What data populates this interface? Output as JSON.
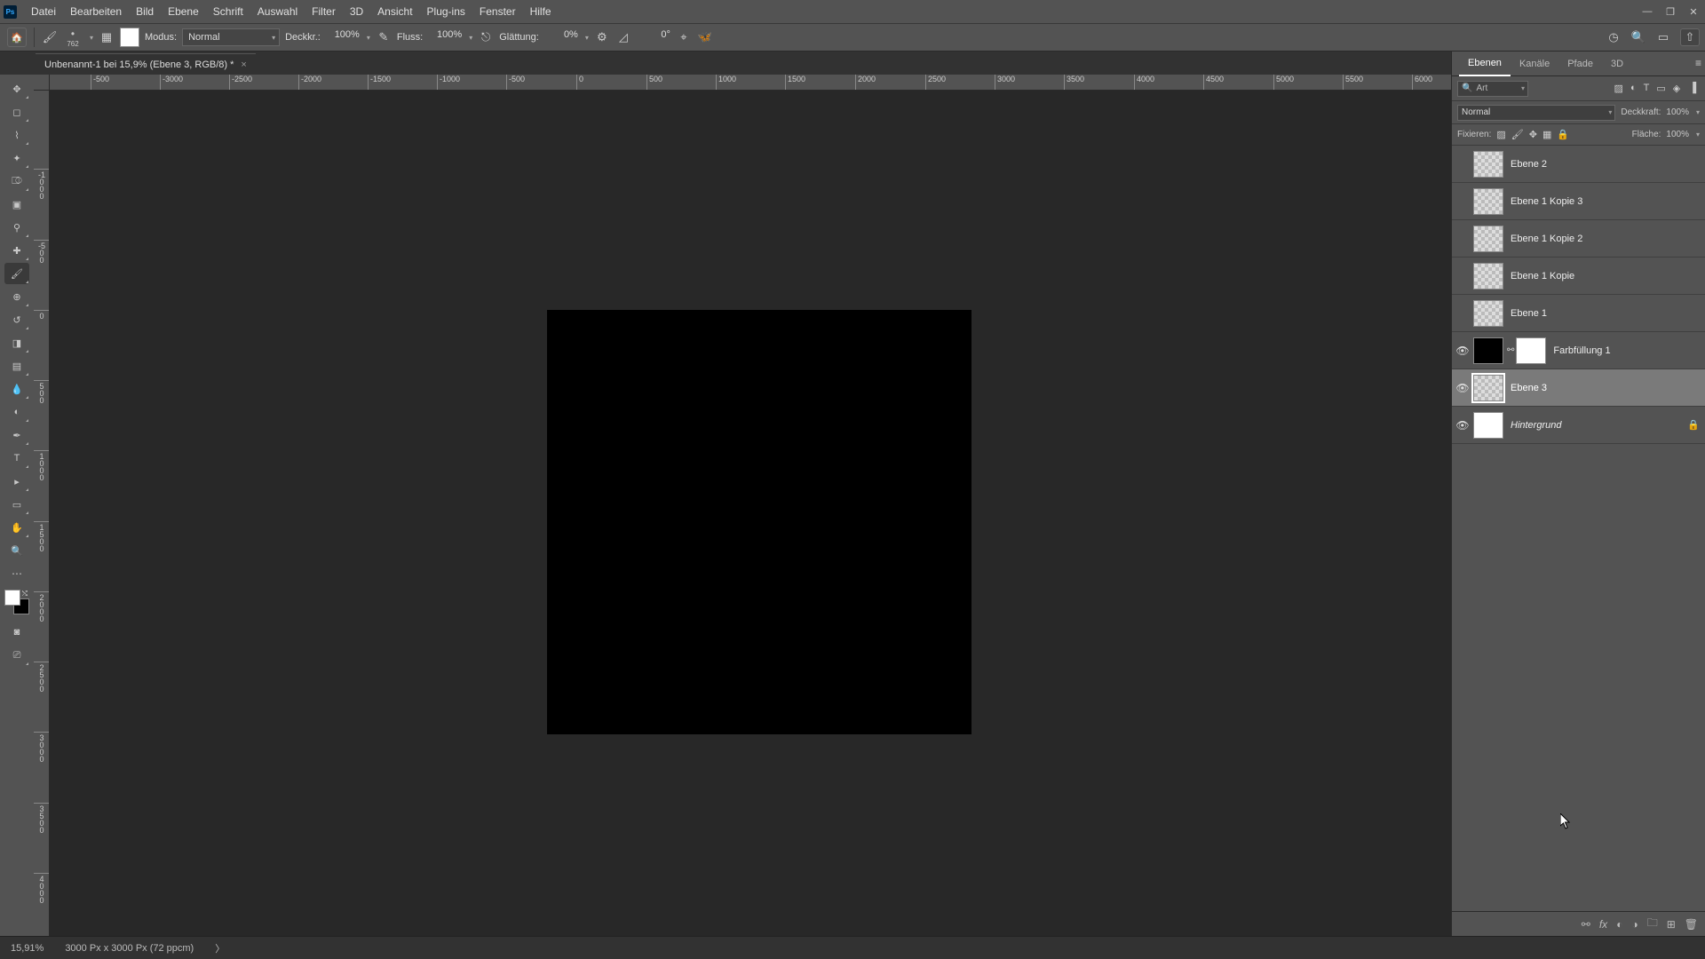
{
  "menu": [
    "Datei",
    "Bearbeiten",
    "Bild",
    "Ebene",
    "Schrift",
    "Auswahl",
    "Filter",
    "3D",
    "Ansicht",
    "Plug-ins",
    "Fenster",
    "Hilfe"
  ],
  "doc_tab": {
    "title": "Unbenannt-1 bei 15,9% (Ebene 3, RGB/8) *"
  },
  "options": {
    "brush_size": "762",
    "mode_label": "Modus:",
    "mode_value": "Normal",
    "opacity_label": "Deckkr.:",
    "opacity_value": "100%",
    "flow_label": "Fluss:",
    "flow_value": "100%",
    "smoothing_label": "Glättung:",
    "smoothing_value": "0%",
    "angle_value": "0°"
  },
  "ruler_h": [
    "-500",
    "-3000",
    "-2500",
    "-2000",
    "-1500",
    "-1000",
    "-500",
    "0",
    "500",
    "1000",
    "1500",
    "2000",
    "2500",
    "3000",
    "3500",
    "4000",
    "4500",
    "5000",
    "5500",
    "6000"
  ],
  "ruler_v": [
    "-1\n0\n0\n0",
    "-5\n0\n0",
    "0",
    "5\n0\n0",
    "1\n0\n0\n0",
    "1\n5\n0\n0",
    "2\n0\n0\n0",
    "2\n5\n0\n0",
    "3\n0\n0\n0",
    "3\n5\n0\n0",
    "4\n0\n0\n0"
  ],
  "panel_tabs": [
    "Ebenen",
    "Kanäle",
    "Pfade",
    "3D"
  ],
  "search_label": "Art",
  "blend_mode": "Normal",
  "opacity_panel": {
    "label": "Deckkraft:",
    "value": "100%"
  },
  "fill_panel": {
    "label": "Fläche:",
    "value": "100%"
  },
  "lock_label": "Fixieren:",
  "layers": [
    {
      "name": "Ebene 2",
      "visible": false,
      "kind": "checker"
    },
    {
      "name": "Ebene 1 Kopie 3",
      "visible": false,
      "kind": "checker"
    },
    {
      "name": "Ebene 1 Kopie 2",
      "visible": false,
      "kind": "checker"
    },
    {
      "name": "Ebene 1 Kopie",
      "visible": false,
      "kind": "checker"
    },
    {
      "name": "Ebene 1",
      "visible": false,
      "kind": "checker"
    },
    {
      "name": "Farbfüllung 1",
      "visible": true,
      "kind": "fill"
    },
    {
      "name": "Ebene 3",
      "visible": true,
      "kind": "checker",
      "selected": true
    },
    {
      "name": "Hintergrund",
      "visible": true,
      "kind": "bg",
      "locked": true
    }
  ],
  "status": {
    "zoom": "15,91%",
    "doc": "3000 Px x 3000 Px (72 ppcm)",
    "caret": "〉"
  }
}
